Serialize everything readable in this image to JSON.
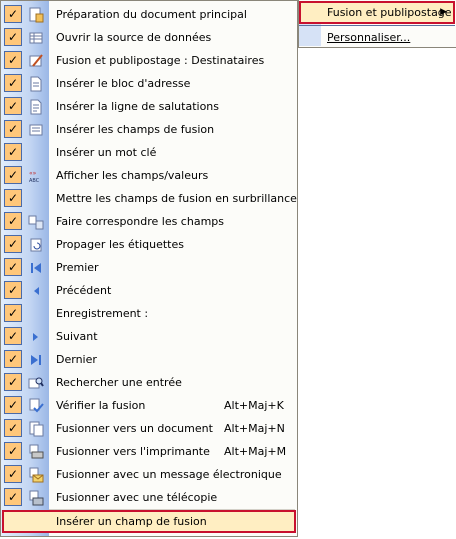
{
  "menu": {
    "items": [
      {
        "label": "Préparation du document principal",
        "shortcut": "",
        "icon": "main-doc-icon",
        "checked": true
      },
      {
        "label": "Ouvrir la source de données",
        "shortcut": "",
        "icon": "data-source-icon",
        "checked": true
      },
      {
        "label": "Fusion et publipostage : Destinataires",
        "shortcut": "",
        "icon": "recipients-icon",
        "checked": true
      },
      {
        "label": "Insérer le bloc d'adresse",
        "shortcut": "",
        "icon": "address-block-icon",
        "checked": true
      },
      {
        "label": "Insérer la ligne de salutations",
        "shortcut": "",
        "icon": "greeting-line-icon",
        "checked": true
      },
      {
        "label": "Insérer les champs de fusion",
        "shortcut": "",
        "icon": "merge-fields-icon",
        "checked": true
      },
      {
        "label": "Insérer un mot clé",
        "shortcut": "",
        "icon": "",
        "checked": true
      },
      {
        "label": "Afficher les champs/valeurs",
        "shortcut": "",
        "icon": "view-fields-icon",
        "checked": true
      },
      {
        "label": "Mettre les champs de fusion en surbrillance",
        "shortcut": "",
        "icon": "",
        "checked": true
      },
      {
        "label": "Faire correspondre les champs",
        "shortcut": "",
        "icon": "match-fields-icon",
        "checked": true
      },
      {
        "label": "Propager les étiquettes",
        "shortcut": "",
        "icon": "propagate-labels-icon",
        "checked": true
      },
      {
        "label": "Premier",
        "shortcut": "",
        "icon": "first-record-icon",
        "checked": true
      },
      {
        "label": "Précédent",
        "shortcut": "",
        "icon": "previous-record-icon",
        "checked": true
      },
      {
        "label": "Enregistrement :",
        "shortcut": "",
        "icon": "",
        "checked": true
      },
      {
        "label": "Suivant",
        "shortcut": "",
        "icon": "next-record-icon",
        "checked": true
      },
      {
        "label": "Dernier",
        "shortcut": "",
        "icon": "last-record-icon",
        "checked": true
      },
      {
        "label": "Rechercher une entrée",
        "shortcut": "",
        "icon": "find-entry-icon",
        "checked": true
      },
      {
        "label": "Vérifier la fusion",
        "shortcut": "Alt+Maj+K",
        "icon": "check-merge-icon",
        "checked": true
      },
      {
        "label": "Fusionner vers un document",
        "shortcut": "Alt+Maj+N",
        "icon": "merge-to-document-icon",
        "checked": true
      },
      {
        "label": "Fusionner vers l'imprimante",
        "shortcut": "Alt+Maj+M",
        "icon": "merge-to-printer-icon",
        "checked": true
      },
      {
        "label": "Fusionner avec un message électronique",
        "shortcut": "",
        "icon": "merge-to-email-icon",
        "checked": true
      },
      {
        "label": "Fusionner avec une télécopie",
        "shortcut": "",
        "icon": "merge-to-fax-icon",
        "checked": true
      }
    ],
    "highlighted_item": {
      "label": "Insérer un champ de fusion"
    }
  },
  "submenu": {
    "selected": {
      "label": "Fusion et publipostage",
      "arrow": "▶"
    },
    "customize": {
      "label": "Personnaliser..."
    }
  },
  "colors": {
    "highlight": "#ffeec2",
    "check_bg": "#ffc77a",
    "red_frame": "#c8102e"
  }
}
